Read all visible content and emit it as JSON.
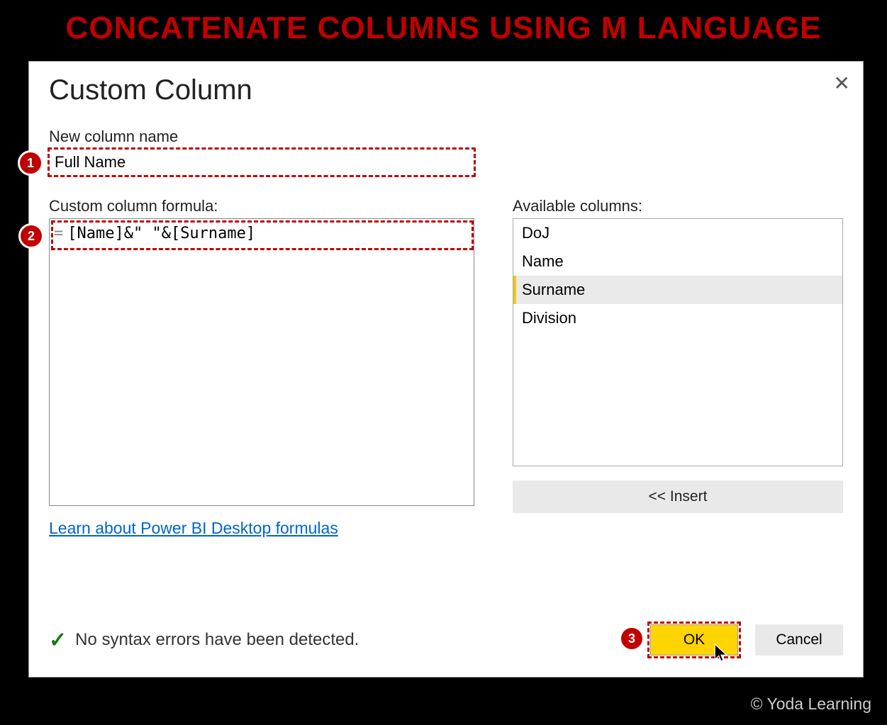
{
  "slide": {
    "title": "CONCATENATE COLUMNS USING M LANGUAGE",
    "copyright": "© Yoda Learning"
  },
  "dialog": {
    "title": "Custom Column",
    "new_column_label": "New column name",
    "new_column_value": "Full Name",
    "formula_label": "Custom column formula:",
    "formula_prefix": "=",
    "formula_code": "[Name]&\" \"&[Surname]",
    "link_text": "Learn about Power BI Desktop formulas",
    "available_label": "Available columns:",
    "available_items": [
      "DoJ",
      "Name",
      "Surname",
      "Division"
    ],
    "available_selected_index": 2,
    "insert_label": "<< Insert",
    "status_text": "No syntax errors have been detected.",
    "ok_label": "OK",
    "cancel_label": "Cancel"
  },
  "callouts": {
    "one": "1",
    "two": "2",
    "three": "3"
  }
}
